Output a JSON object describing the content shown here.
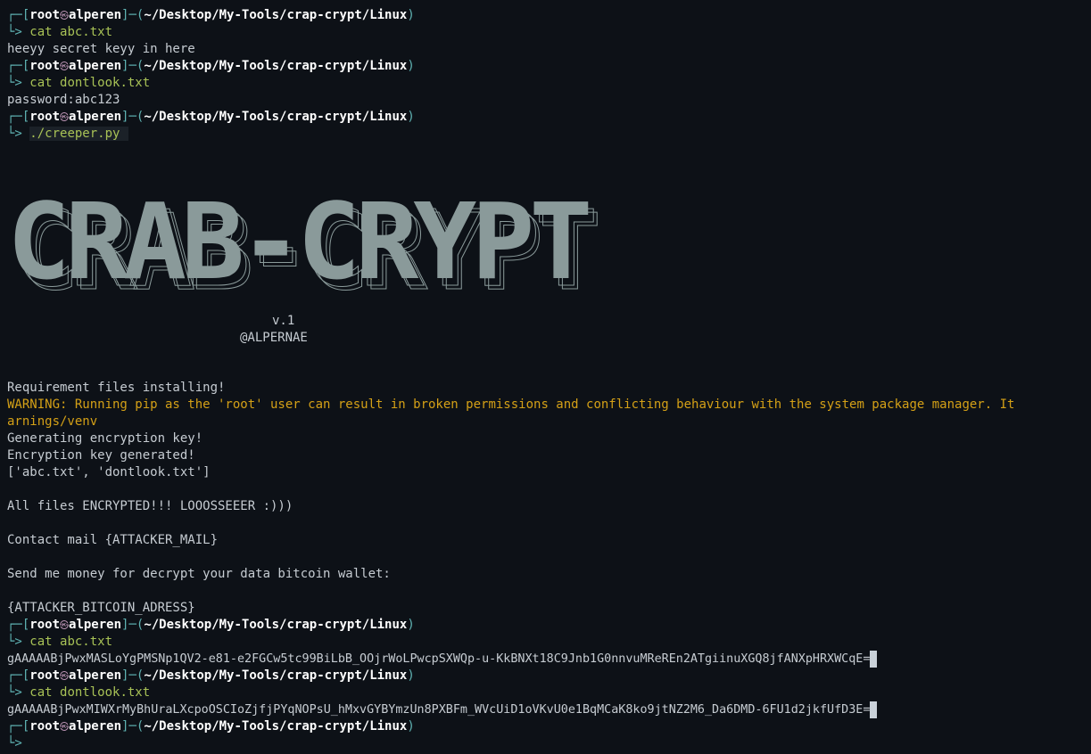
{
  "prompt": {
    "user": "root",
    "at": "㉿",
    "host": "alperen",
    "path": "~/Desktop/My-Tools/crap-crypt/Linux",
    "top_prefix": "┌─[",
    "mid": "]─(",
    "end": ")",
    "bottom_prefix": "└> "
  },
  "session": {
    "cmd1": "cat abc.txt",
    "out1": "heeyy secret keyy in here",
    "cmd2": "cat dontlook.txt",
    "out2": "password:abc123",
    "cmd3": "./creeper.py",
    "banner_text": "CRAB-CRYPT",
    "version": "v.1",
    "author": "@ALPERNAE",
    "req_install": "Requirement files installing!",
    "warning_line1": "WARNING: Running pip as the 'root' user can result in broken permissions and conflicting behaviour with the system package manager. It",
    "warning_line2": "arnings/venv",
    "gen_key": "Generating encryption key!",
    "key_generated": "Encryption key generated!",
    "files_list": "['abc.txt', 'dontlook.txt']",
    "encrypted_msg": "All files ENCRYPTED!!! LOOOSSEEER :)))",
    "contact_mail": "Contact mail {ATTACKER_MAIL}",
    "send_money": "Send me money for decrypt your data bitcoin wallet:",
    "bitcoin_addr": "{ATTACKER_BITCOIN_ADRESS}",
    "cmd4": "cat abc.txt",
    "cipher1": "gAAAAABjPwxMASLoYgPMSNp1QV2-e81-e2FGCw5tc99BiLbB_OOjrWoLPwcpSXWQp-u-KkBNXt18C9Jnb1G0nnvuMReREn2ATgiinuXGQ8jfANXpHRXWCqE=",
    "cmd5": "cat dontlook.txt",
    "cipher2": "gAAAAABjPwxMIWXrMyBhUraLXcpoOSCIoZjfjPYqNOPsU_hMxvGYBYmzUn8PXBFm_WVcUiD1oVKvU0e1BqMCaK8ko9jtNZ2M6_Da6DMD-6FU1d2jkfUfD3E="
  },
  "colors": {
    "background": "#0d1117",
    "prompt_accent": "#5fb3b3",
    "command": "#a8c256",
    "warning": "#d4a017",
    "banner": "#8a9a9a"
  }
}
